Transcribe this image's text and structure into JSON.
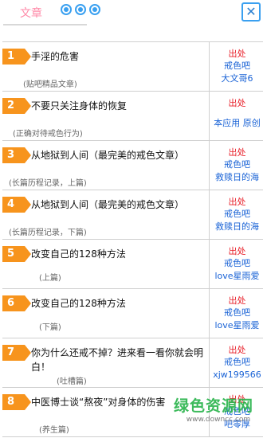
{
  "header": {
    "tab_title": "文章",
    "close_symbol": "✕"
  },
  "items": [
    {
      "num": "1",
      "title": "手淫的危害",
      "sub": "(贴吧精品文章)",
      "src_label": "出处",
      "src_lines": [
        "戒色吧",
        "大文哥6"
      ]
    },
    {
      "num": "2",
      "title": "不要只关注身体的恢复",
      "sub": "(正确对待戒色行为)",
      "src_label": "出处",
      "src_lines": [
        "本应用 原创"
      ]
    },
    {
      "num": "3",
      "title": "从地狱到人间（最完美的戒色文章）",
      "sub": "(长篇历程记录，上篇)",
      "src_label": "出处",
      "src_lines": [
        "戒色吧",
        "救赎日的海"
      ]
    },
    {
      "num": "4",
      "title": "从地狱到人间（最完美的戒色文章）",
      "sub": "(长篇历程记录，下篇)",
      "src_label": "出处",
      "src_lines": [
        "戒色吧",
        "救赎日的海"
      ]
    },
    {
      "num": "5",
      "title": "改变自己的128种方法",
      "sub": "(上篇)",
      "src_label": "出处",
      "src_lines": [
        "戒色吧",
        "love星雨爱"
      ]
    },
    {
      "num": "6",
      "title": "改变自己的128种方法",
      "sub": "(下篇)",
      "src_label": "出处",
      "src_lines": [
        "戒色吧",
        "love星雨爱"
      ]
    },
    {
      "num": "7",
      "title": "你为什么还戒不掉？进来看一看你就会明白！",
      "sub": "(吐槽篇)",
      "src_label": "出处",
      "src_lines": [
        "戒色吧",
        "xjw199566"
      ]
    },
    {
      "num": "8",
      "title": "中医博士谈“熬夜”对身体的伤害",
      "sub": "(养生篇)",
      "src_label": "出处",
      "src_lines": [
        "戒色吧",
        "吧零厚"
      ]
    }
  ],
  "watermark": {
    "main": "绿色资源网",
    "url": "www.downcc.com"
  },
  "colors": {
    "accent_blue": "#3aa0f0",
    "number_orange": "#f7941d",
    "source_red": "#e8202a",
    "source_blue": "#1a63d6"
  }
}
